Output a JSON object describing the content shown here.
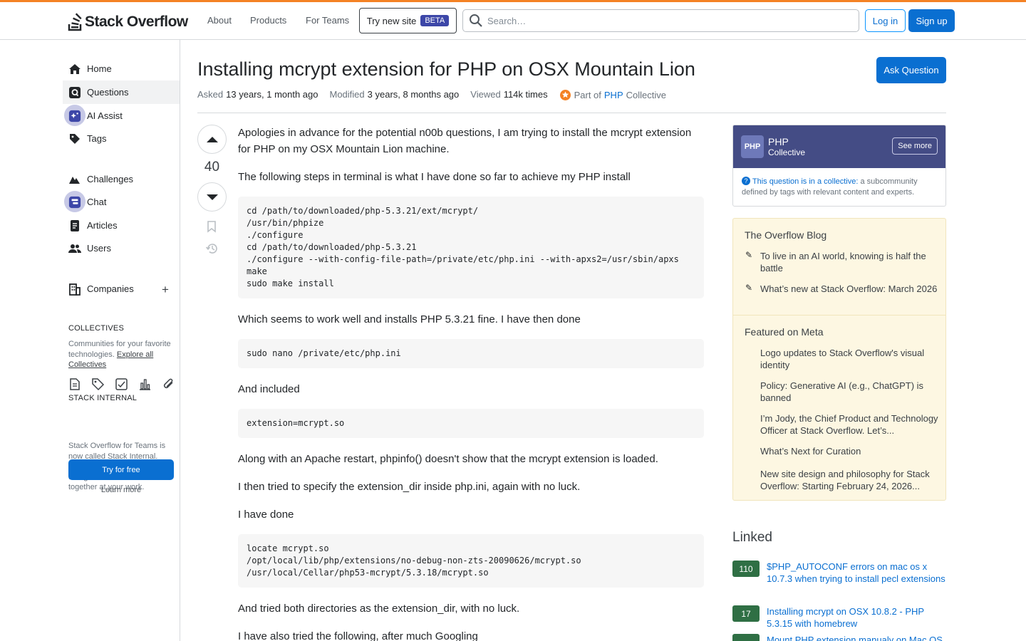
{
  "header": {
    "logo_text": "Stack Overflow",
    "nav": [
      "About",
      "Products",
      "For Teams"
    ],
    "try_new_site": "Try new site",
    "beta": "BETA",
    "search_placeholder": "Search…",
    "login": "Log in",
    "signup": "Sign up",
    "accent_color": "#f48225"
  },
  "sidebar": {
    "items": [
      {
        "label": "Home",
        "icon": "home-icon"
      },
      {
        "label": "Questions",
        "icon": "questions-icon"
      },
      {
        "label": "AI Assist",
        "icon": "ai-assist-icon"
      },
      {
        "label": "Tags",
        "icon": "tag-icon"
      },
      {
        "label": "Challenges",
        "icon": "challenges-icon"
      },
      {
        "label": "Chat",
        "icon": "chat-icon"
      },
      {
        "label": "Articles",
        "icon": "articles-icon"
      },
      {
        "label": "Users",
        "icon": "users-icon"
      },
      {
        "label": "Companies",
        "icon": "companies-icon"
      }
    ],
    "active_item": "Questions",
    "collectives_title": "COLLECTIVES",
    "collectives_text": "Communities for your favorite technologies.",
    "explore_link": "Explore all Collectives",
    "stack_internal_title": "STACK INTERNAL",
    "stack_internal_text": "Stack Overflow for Teams is now called Stack Internal. Bring the best of human thought and AI automation together at your work.",
    "try_free": "Try for free",
    "learn_more": "Learn more"
  },
  "question": {
    "title": "Installing mcrypt extension for PHP on OSX Mountain Lion",
    "ask_button": "Ask Question",
    "asked_label": "Asked",
    "asked_value": "13 years, 1 month ago",
    "modified_label": "Modified",
    "modified_value": "3 years, 8 months ago",
    "viewed_label": "Viewed",
    "viewed_value": "114k times",
    "part_of": "Part of",
    "collective_link": "PHP",
    "collective_suffix": "Collective",
    "votes": "40",
    "body": {
      "p1": "Apologies in advance for the potential n00b questions, I am trying to install the mcrypt extension for PHP on my OSX Mountain Lion machine.",
      "p2": "The following steps in terminal is what I have done so far to achieve my PHP install",
      "code1": "cd /path/to/downloaded/php-5.3.21/ext/mcrypt/\n/usr/bin/phpize\n./configure\ncd /path/to/downloaded/php-5.3.21\n./configure --with-config-file-path=/private/etc/php.ini --with-apxs2=/usr/sbin/apxs\nmake\nsudo make install",
      "p3": "Which seems to work well and installs PHP 5.3.21 fine. I have then done",
      "code2": "sudo nano /private/etc/php.ini",
      "p4": "And included",
      "code3": "extension=mcrypt.so",
      "p5": "Along with an Apache restart, phpinfo() doesn't show that the mcrypt extension is loaded.",
      "p6": "I then tried to specify the extension_dir inside php.ini, again with no luck.",
      "p7": "I have done",
      "code4": "locate mcrypt.so\n/opt/local/lib/php/extensions/no-debug-non-zts-20090626/mcrypt.so\n/usr/local/Cellar/php53-mcrypt/5.3.18/mcrypt.so",
      "p8": "And tried both directories as the extension_dir, with no luck.",
      "p9": "I have also tried the following, after much Googling"
    }
  },
  "right": {
    "collective_badge": "PHP",
    "collective_name": "PHP",
    "collective_sub": "Collective",
    "see_more": "See more",
    "note_link": "This question is in a collective:",
    "note_text": " a subcommunity defined by tags with relevant content and experts.",
    "blog_title": "The Overflow Blog",
    "blog_items": [
      "To live in an AI world, knowing is half the battle",
      "What’s new at Stack Overflow: March 2026"
    ],
    "meta_title": "Featured on Meta",
    "meta_items": [
      "Logo updates to Stack Overflow's visual identity",
      "Policy: Generative AI (e.g., ChatGPT) is banned",
      "I’m Jody, the Chief Product and Technology Officer at Stack Overflow. Let’s...",
      "What’s Next for Curation",
      "New site design and philosophy for Stack Overflow: Starting February 24, 2026..."
    ],
    "linked_title": "Linked",
    "linked": [
      {
        "score": "110",
        "title": "$PHP_AUTOCONF errors on mac os x 10.7.3 when trying to install pecl extensions"
      },
      {
        "score": "17",
        "title": "Installing mcrypt on OSX 10.8.2 - PHP 5.3.15 with homebrew"
      },
      {
        "score": "",
        "title": "Mount PHP extension manualy on Mac OS X"
      }
    ]
  }
}
